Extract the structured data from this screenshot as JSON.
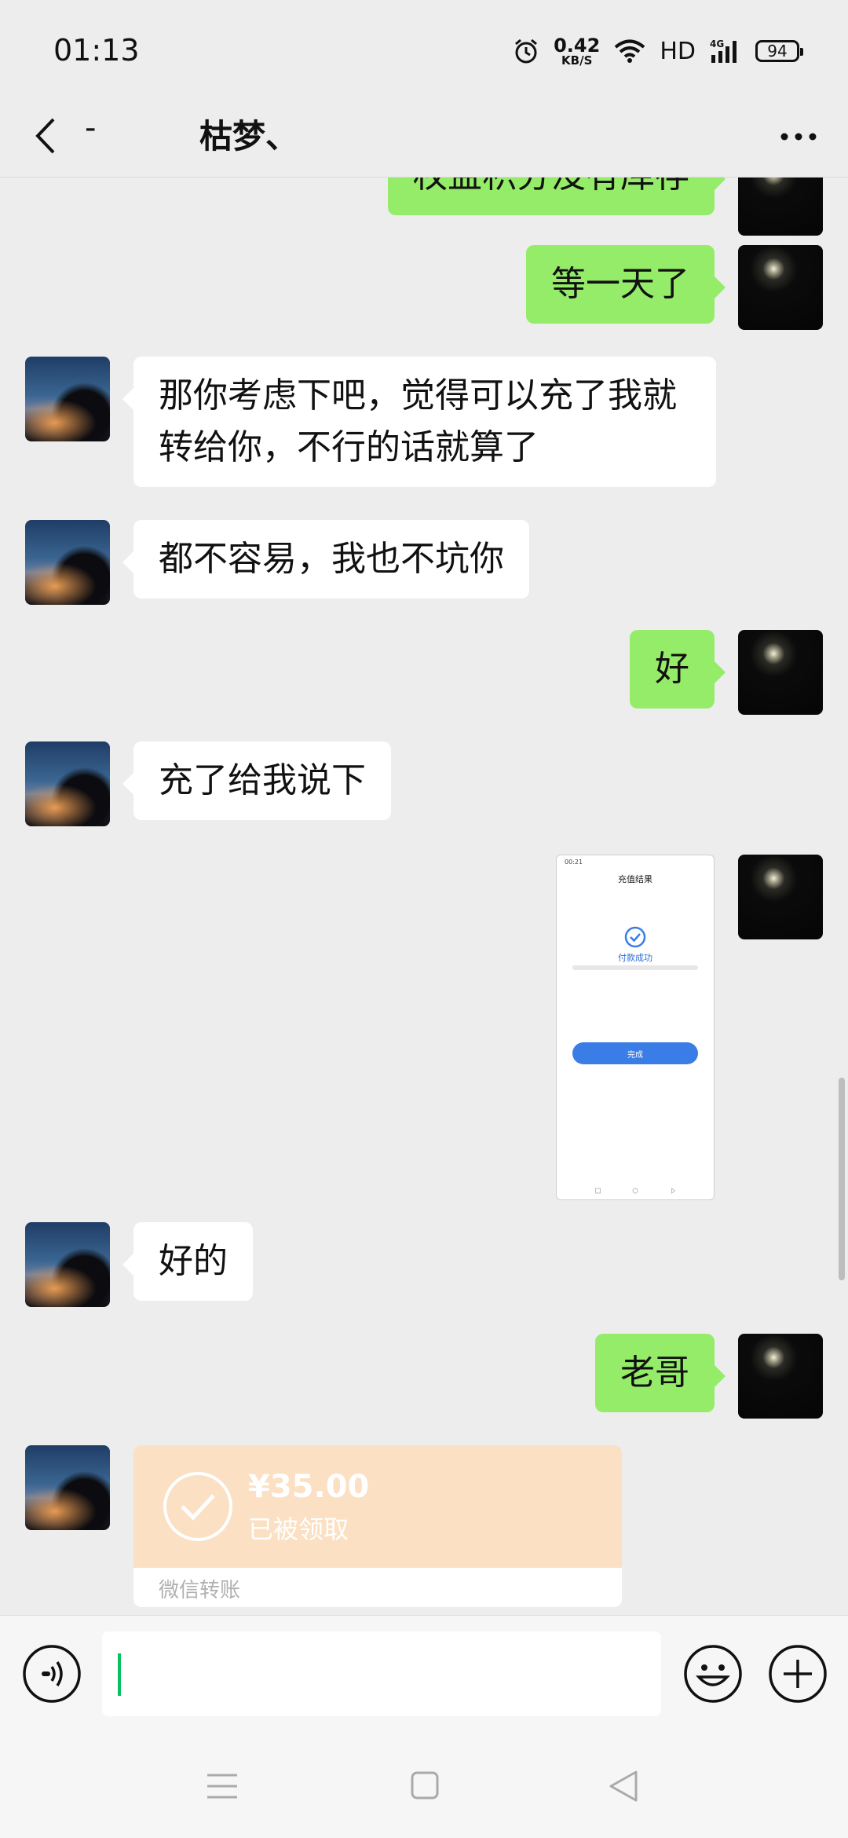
{
  "status_bar": {
    "time": "01:13",
    "net_speed_value": "0.42",
    "net_speed_unit": "KB/S",
    "hd_label": "HD",
    "signal_label": "4G",
    "battery": "94"
  },
  "header": {
    "back_icon": "chevron-left-icon",
    "dash": "-",
    "title": "枯梦、",
    "more_icon": "more-dots-icon"
  },
  "messages": [
    {
      "side": "out",
      "type": "text",
      "text": "权益积分没有库存"
    },
    {
      "side": "out",
      "type": "text",
      "text": "等一天了"
    },
    {
      "side": "in",
      "type": "text",
      "line1": "那你考虑下吧，觉得可以充了我就",
      "line2": "转给你，不行的话就算了"
    },
    {
      "side": "in",
      "type": "text",
      "text": "都不容易，我也不坑你"
    },
    {
      "side": "out",
      "type": "text",
      "text": "好"
    },
    {
      "side": "in",
      "type": "text",
      "text": "充了给我说下"
    },
    {
      "side": "out",
      "type": "image",
      "image": {
        "status_time": "00:21",
        "title": "充值结果",
        "success": "付款成功",
        "button": "完成"
      }
    },
    {
      "side": "in",
      "type": "text",
      "text": "好的"
    },
    {
      "side": "out",
      "type": "text",
      "text": "老哥"
    },
    {
      "side": "in",
      "type": "transfer",
      "transfer": {
        "amount": "¥35.00",
        "status": "已被领取",
        "label": "微信转账"
      }
    }
  ],
  "input_bar": {
    "voice_icon": "voice-icon",
    "emoji_icon": "emoji-icon",
    "plus_icon": "plus-icon",
    "text_value": ""
  },
  "nav_bar": {
    "menu_icon": "menu-icon",
    "home_icon": "home-icon",
    "back_icon": "back-triangle-icon"
  },
  "colors": {
    "background": "#ededed",
    "outgoing_bubble": "#95ec69",
    "incoming_bubble": "#ffffff",
    "transfer_card": "#fbe0c3",
    "cursor": "#07c160"
  }
}
